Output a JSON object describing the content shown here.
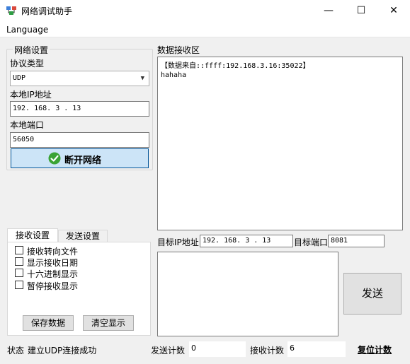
{
  "window": {
    "title": "网络调试助手",
    "minimize_glyph": "—",
    "maximize_glyph": "☐",
    "close_glyph": "✕"
  },
  "menu": {
    "items": [
      {
        "label": "Language"
      }
    ]
  },
  "network": {
    "group_title": "网络设置",
    "protocol_label": "协议类型",
    "protocol_value": "UDP",
    "local_ip_label": "本地IP地址",
    "local_ip_value": "192. 168. 3   . 13",
    "local_port_label": "本地端口",
    "local_port_value": "56050",
    "connect_button": "断开网络",
    "connect_icon": "check-circle-icon"
  },
  "receive": {
    "area_label": "数据接收区",
    "lines": [
      "【数据来自::ffff:192.168.3.16:35022】",
      "hahaha"
    ]
  },
  "tabs": [
    {
      "label": "接收设置",
      "active": true
    },
    {
      "label": "发送设置",
      "active": false
    }
  ],
  "receive_settings": {
    "options": [
      {
        "label": "接收转向文件",
        "checked": false
      },
      {
        "label": "显示接收日期",
        "checked": false
      },
      {
        "label": "十六进制显示",
        "checked": false
      },
      {
        "label": "暂停接收显示",
        "checked": false
      }
    ],
    "save_button": "保存数据",
    "clear_button": "清空显示"
  },
  "target": {
    "ip_label": "目标IP地址",
    "ip_value": "192. 168. 3   . 13",
    "port_label": "目标端口",
    "port_value": "8081"
  },
  "send": {
    "text": "",
    "button": "发送"
  },
  "status": {
    "label": "状态",
    "text": "建立UDP连接成功",
    "send_count_label": "发送计数",
    "send_count_value": "0",
    "recv_count_label": "接收计数",
    "recv_count_value": "6",
    "reset_button": "复位计数"
  },
  "colors": {
    "accent": "#0078d7",
    "button_blue": "#cce4f7",
    "check_green": "#3aa335"
  }
}
